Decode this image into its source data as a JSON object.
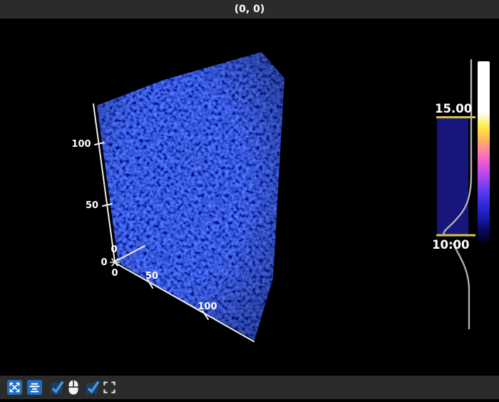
{
  "window": {
    "title": "(0, 0)",
    "titlebar_bg": "#2b2b2b",
    "canvas_bg": "#000000"
  },
  "scene": {
    "type": "3d-volume-render",
    "volume_base_color": "#0a0acc",
    "axes": {
      "axis_color": "#f0f0f0",
      "y_ticks": [
        "50",
        "100"
      ],
      "x_ticks": [
        "50",
        "100"
      ],
      "origin_zeros": [
        "0",
        "0",
        "0"
      ]
    }
  },
  "histogram_lut": {
    "vmax_label": "15.00",
    "vmin_label": "10:00",
    "region_fill": "#16167c",
    "edge_color": "#d8c53e",
    "curve_color": "#b5b5b5",
    "colorbar_colors": [
      "#ffffff",
      "#ffec40",
      "#ffb558",
      "#ff7fae",
      "#ee55d6",
      "#ae49e8",
      "#6d3cf2",
      "#3430e0",
      "#1b1bba",
      "#09095e",
      "#000014"
    ]
  },
  "toolbar": {
    "bg": "#2b2b2b",
    "button_blue": "#1c6fc4",
    "check_blue": "#3f9bf0",
    "checkbox_bg": "#1e3d5c",
    "buttons": [
      {
        "name": "panzoom",
        "icon": "arrows-expand-icon",
        "state": "active"
      },
      {
        "name": "center-scene",
        "icon": "align-center-icon",
        "state": "active"
      },
      {
        "name": "controller-toggle-1",
        "icon": "checkbox-checked-icon",
        "checked": true
      },
      {
        "name": "mouse-mode",
        "icon": "mouse-icon"
      },
      {
        "name": "controller-toggle-2",
        "icon": "checkbox-checked-icon",
        "checked": true
      },
      {
        "name": "fullscreen",
        "icon": "fullscreen-icon"
      }
    ]
  }
}
